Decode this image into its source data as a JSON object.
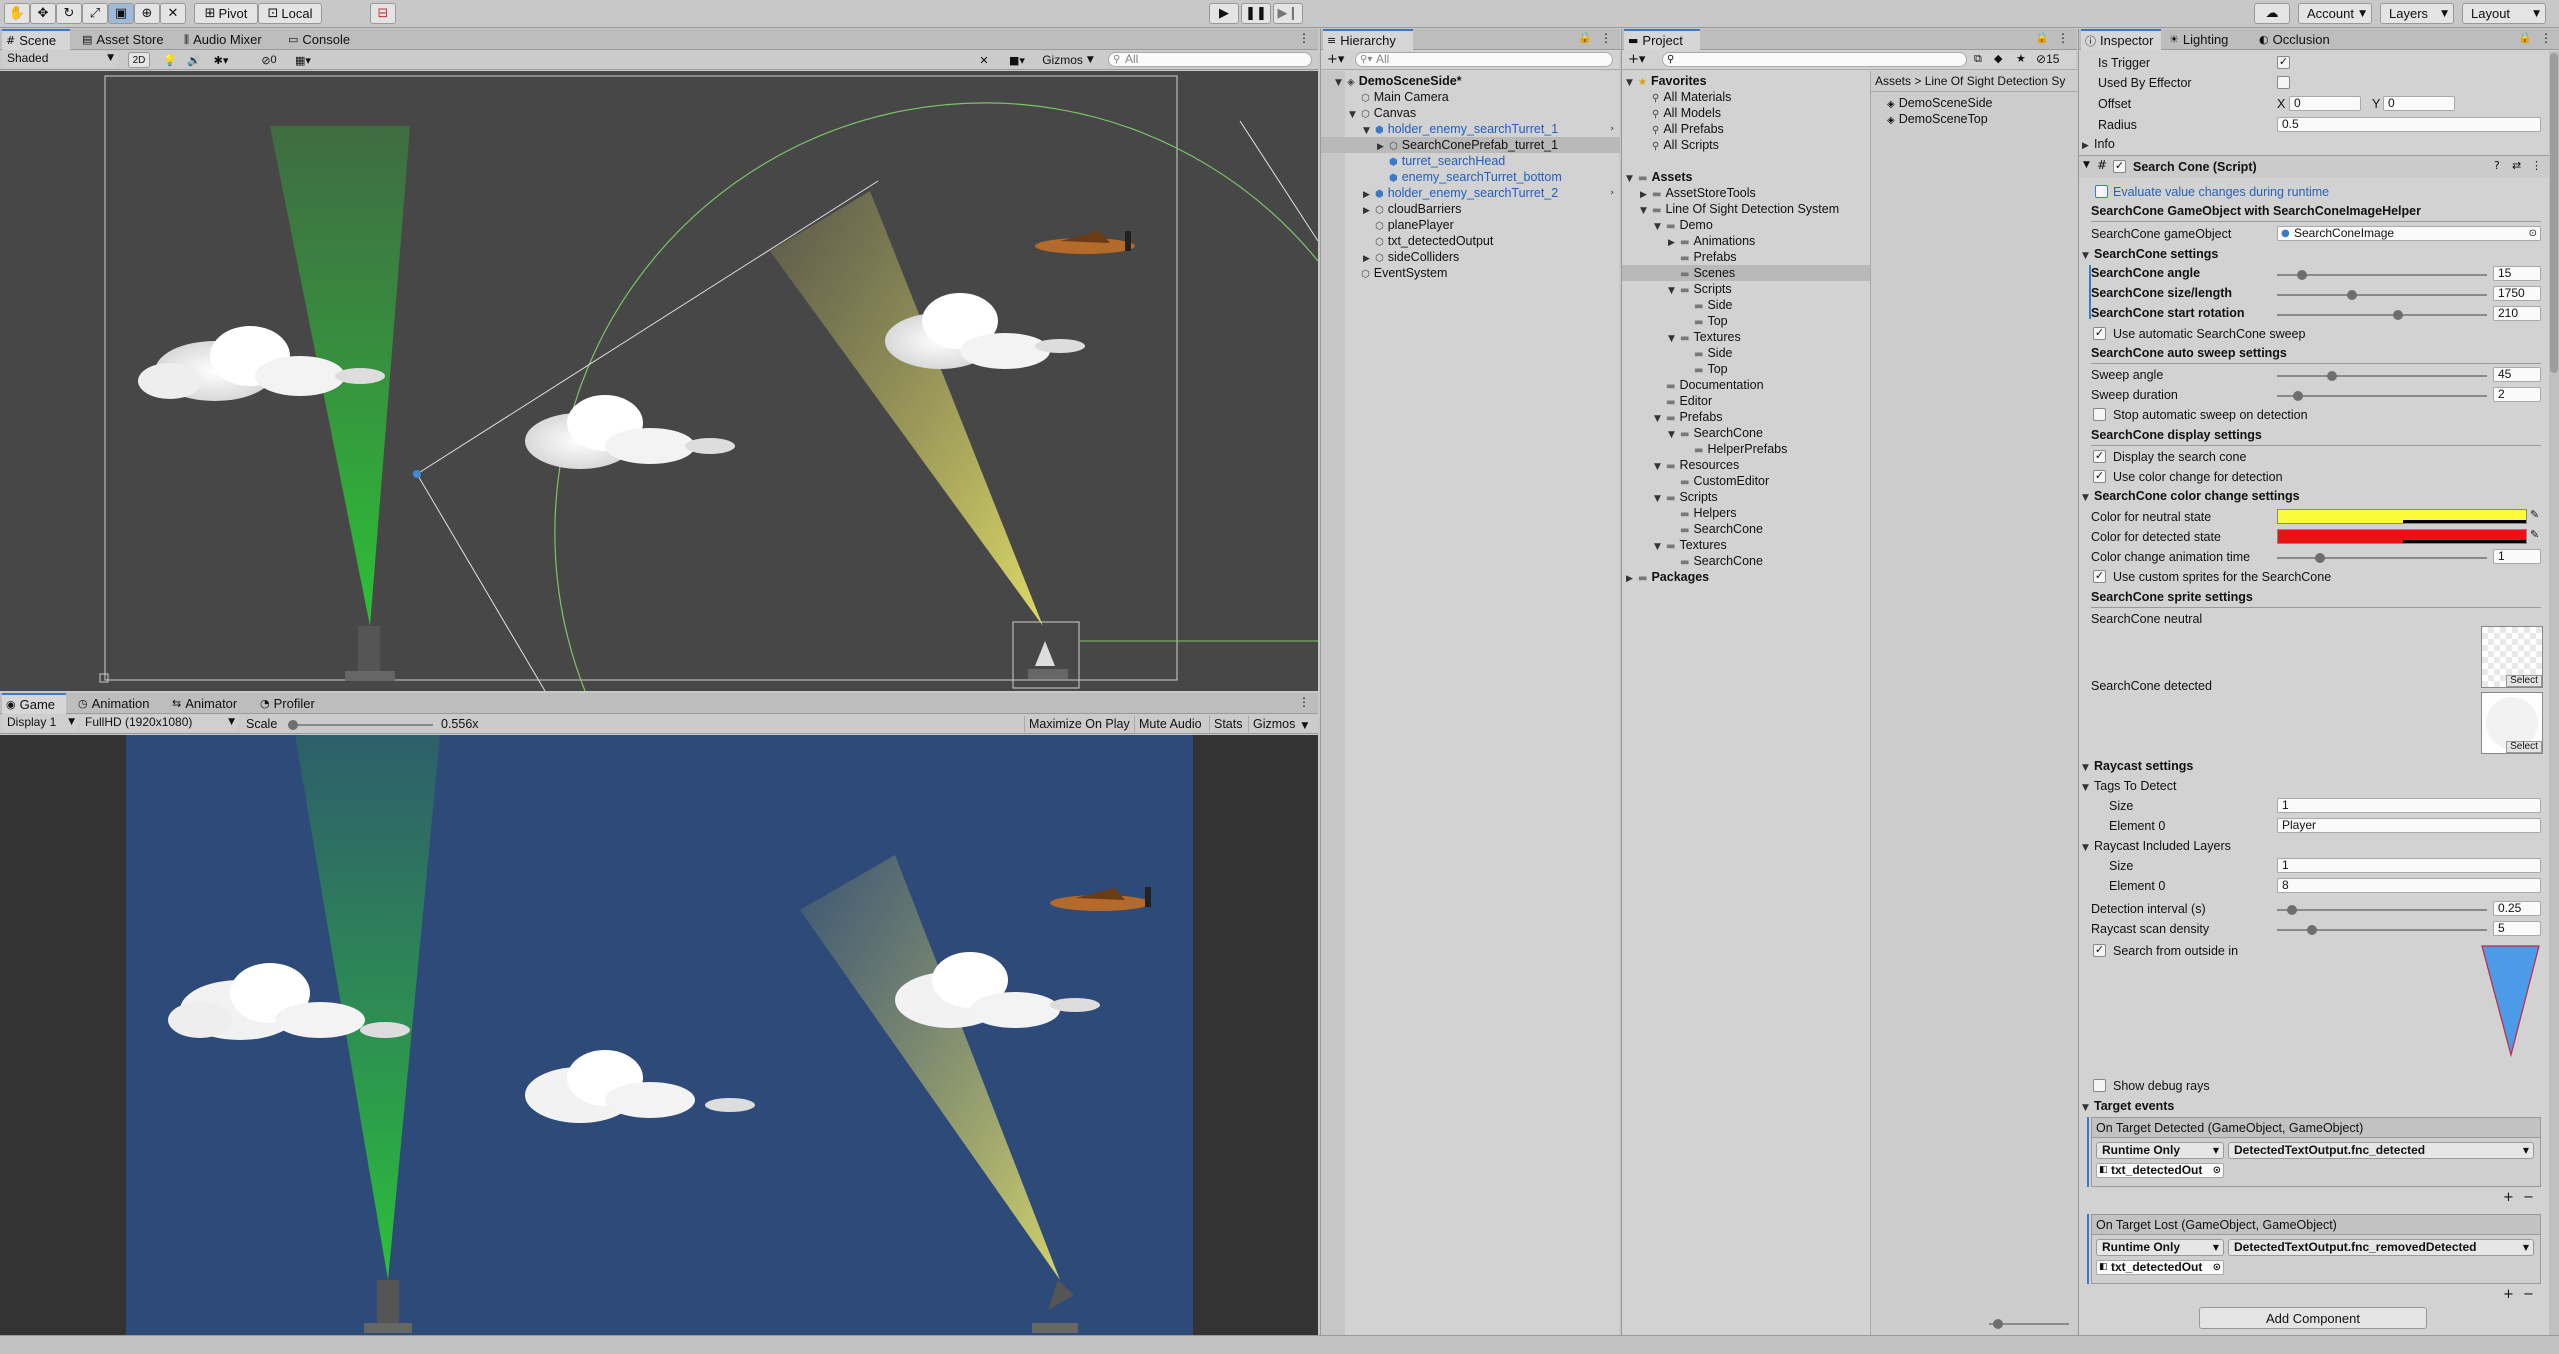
{
  "toolbar": {
    "pivot": "Pivot",
    "local": "Local",
    "account": "Account",
    "layers": "Layers",
    "layout": "Layout"
  },
  "scene": {
    "tabs": [
      "Scene",
      "Asset Store",
      "Audio Mixer",
      "Console"
    ],
    "shading": "Shaded",
    "mode2d": "2D",
    "hidden_count": "0",
    "gizmos": "Gizmos",
    "search_placeholder": "All"
  },
  "game": {
    "tabs": [
      "Game",
      "Animation",
      "Animator",
      "Profiler"
    ],
    "display": "Display 1",
    "resolution": "FullHD (1920x1080)",
    "scale_label": "Scale",
    "scale_value": "0.556x",
    "buttons": [
      "Maximize On Play",
      "Mute Audio",
      "Stats",
      "Gizmos"
    ]
  },
  "hierarchy": {
    "title": "Hierarchy",
    "search_placeholder": "All",
    "items": [
      {
        "label": "DemoSceneSide*",
        "depth": 0,
        "arrow": "down",
        "bold": true
      },
      {
        "label": "Main Camera",
        "depth": 1,
        "arrow": ""
      },
      {
        "label": "Canvas",
        "depth": 1,
        "arrow": "down"
      },
      {
        "label": "holder_enemy_searchTurret_1",
        "depth": 2,
        "arrow": "down",
        "blue": true
      },
      {
        "label": "SearchConePrefab_turret_1",
        "depth": 3,
        "arrow": "right",
        "selected": true
      },
      {
        "label": "turret_searchHead",
        "depth": 3,
        "arrow": "",
        "blue": true
      },
      {
        "label": "enemy_searchTurret_bottom",
        "depth": 3,
        "arrow": "",
        "blue": true
      },
      {
        "label": "holder_enemy_searchTurret_2",
        "depth": 2,
        "arrow": "right",
        "blue": true
      },
      {
        "label": "cloudBarriers",
        "depth": 2,
        "arrow": "right"
      },
      {
        "label": "planePlayer",
        "depth": 2,
        "arrow": ""
      },
      {
        "label": "txt_detectedOutput",
        "depth": 2,
        "arrow": ""
      },
      {
        "label": "sideColliders",
        "depth": 2,
        "arrow": "right"
      },
      {
        "label": "EventSystem",
        "depth": 1,
        "arrow": ""
      }
    ]
  },
  "project": {
    "title": "Project",
    "badge": "15",
    "breadcrumb": "Assets > Line Of Sight Detection Sy",
    "files": [
      "DemoSceneSide",
      "DemoSceneTop"
    ],
    "tree": [
      {
        "label": "Favorites",
        "depth": 0,
        "arrow": "down",
        "bold": true
      },
      {
        "label": "All Materials",
        "depth": 1,
        "arrow": ""
      },
      {
        "label": "All Models",
        "depth": 1,
        "arrow": ""
      },
      {
        "label": "All Prefabs",
        "depth": 1,
        "arrow": ""
      },
      {
        "label": "All Scripts",
        "depth": 1,
        "arrow": ""
      },
      {
        "label": "",
        "depth": 0,
        "arrow": ""
      },
      {
        "label": "Assets",
        "depth": 0,
        "arrow": "down",
        "bold": true
      },
      {
        "label": "AssetStoreTools",
        "depth": 1,
        "arrow": "right"
      },
      {
        "label": "Line Of Sight Detection System",
        "depth": 1,
        "arrow": "down"
      },
      {
        "label": "Demo",
        "depth": 2,
        "arrow": "down"
      },
      {
        "label": "Animations",
        "depth": 3,
        "arrow": "right"
      },
      {
        "label": "Prefabs",
        "depth": 3,
        "arrow": ""
      },
      {
        "label": "Scenes",
        "depth": 3,
        "arrow": "",
        "selected": true
      },
      {
        "label": "Scripts",
        "depth": 3,
        "arrow": "down"
      },
      {
        "label": "Side",
        "depth": 4,
        "arrow": ""
      },
      {
        "label": "Top",
        "depth": 4,
        "arrow": ""
      },
      {
        "label": "Textures",
        "depth": 3,
        "arrow": "down"
      },
      {
        "label": "Side",
        "depth": 4,
        "arrow": ""
      },
      {
        "label": "Top",
        "depth": 4,
        "arrow": ""
      },
      {
        "label": "Documentation",
        "depth": 2,
        "arrow": ""
      },
      {
        "label": "Editor",
        "depth": 2,
        "arrow": ""
      },
      {
        "label": "Prefabs",
        "depth": 2,
        "arrow": "down"
      },
      {
        "label": "SearchCone",
        "depth": 3,
        "arrow": "down"
      },
      {
        "label": "HelperPrefabs",
        "depth": 4,
        "arrow": ""
      },
      {
        "label": "Resources",
        "depth": 2,
        "arrow": "down"
      },
      {
        "label": "CustomEditor",
        "depth": 3,
        "arrow": ""
      },
      {
        "label": "Scripts",
        "depth": 2,
        "arrow": "down"
      },
      {
        "label": "Helpers",
        "depth": 3,
        "arrow": ""
      },
      {
        "label": "SearchCone",
        "depth": 3,
        "arrow": ""
      },
      {
        "label": "Textures",
        "depth": 2,
        "arrow": "down"
      },
      {
        "label": "SearchCone",
        "depth": 3,
        "arrow": ""
      },
      {
        "label": "Packages",
        "depth": 0,
        "arrow": "right",
        "bold": true
      }
    ]
  },
  "inspector": {
    "tabs": [
      "Inspector",
      "Lighting",
      "Occlusion"
    ],
    "collider": {
      "is_trigger": "Is Trigger",
      "used_by_effector": "Used By Effector",
      "offset": "Offset",
      "offset_x": "0",
      "offset_y": "0",
      "radius": "Radius",
      "radius_value": "0.5",
      "info": "Info"
    },
    "component": "Search Cone (Script)",
    "evaluate": "Evaluate value changes during runtime",
    "helper_title": "SearchCone GameObject with SearchConeImageHelper",
    "go_label": "SearchCone gameObject",
    "go_value": "SearchConeImage",
    "settings_title": "SearchCone settings",
    "angle_label": "SearchCone angle",
    "angle_value": "15",
    "angle_fill": 0.1,
    "size_label": "SearchCone size/length",
    "size_value": "1750",
    "size_fill": 0.35,
    "rotation_label": "SearchCone start rotation",
    "rotation_value": "210",
    "rotation_fill": 0.58,
    "auto_sweep": "Use automatic SearchCone sweep",
    "sweep_title": "SearchCone auto sweep settings",
    "sweep_angle_label": "Sweep angle",
    "sweep_angle_value": "45",
    "sweep_angle_fill": 0.25,
    "sweep_duration_label": "Sweep duration",
    "sweep_duration_value": "2",
    "sweep_duration_fill": 0.08,
    "stop_sweep": "Stop automatic sweep on detection",
    "display_title": "SearchCone display settings",
    "display_cone": "Display the search cone",
    "color_change": "Use color change for detection",
    "color_title": "SearchCone color change settings",
    "neutral_label": "Color for neutral state",
    "neutral_color": "#fbfb3c",
    "detected_label": "Color for detected state",
    "detected_color": "#ee1111",
    "anim_label": "Color change animation time",
    "anim_value": "1",
    "anim_fill": 0.19,
    "custom_sprites": "Use custom sprites for the SearchCone",
    "sprite_title": "SearchCone sprite settings",
    "sprite_neutral": "SearchCone neutral",
    "sprite_detected": "SearchCone detected",
    "select": "Select",
    "raycast_title": "Raycast settings",
    "tags_label": "Tags To Detect",
    "size_word": "Size",
    "tags_size": "1",
    "element0": "Element 0",
    "tags_el0": "Player",
    "layers_label": "Raycast Included Layers",
    "layers_size": "1",
    "layers_el0": "8",
    "interval_label": "Detection interval (s)",
    "interval_value": "0.25",
    "interval_fill": 0.05,
    "density_label": "Raycast scan density",
    "density_value": "5",
    "density_fill": 0.15,
    "outside_in": "Search from outside in",
    "debug_rays": "Show debug rays",
    "events_title": "Target events",
    "on_detected": "On Target Detected (GameObject, GameObject)",
    "on_lost": "On Target Lost (GameObject, GameObject)",
    "runtime_only": "Runtime Only",
    "fn_detected": "DetectedTextOutput.fnc_detected",
    "fn_removed": "DetectedTextOutput.fnc_removedDetected",
    "target_obj": "txt_detectedOut",
    "add_component": "Add Component"
  }
}
